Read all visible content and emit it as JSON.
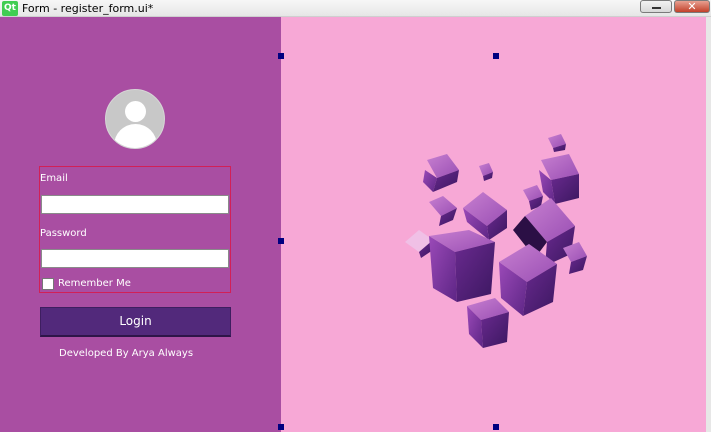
{
  "window": {
    "logo_text": "Qt",
    "title": "Form - register_form.ui*",
    "close_glyph": "✕"
  },
  "form": {
    "email_label": "Email",
    "email_value": "",
    "password_label": "Password",
    "password_value": "",
    "remember_label": "Remember Me",
    "remember_checked": false,
    "login_label": "Login",
    "credit": "Developed By Arya Always"
  },
  "icons": {
    "avatar": "user-avatar-icon",
    "illustration": "purple-cubes-illustration"
  },
  "colors": {
    "left_panel": "#a94ea2",
    "right_panel": "#f7a8d6",
    "login_button": "#52297b",
    "form_border": "#d22056",
    "selection_handle": "#000080"
  }
}
